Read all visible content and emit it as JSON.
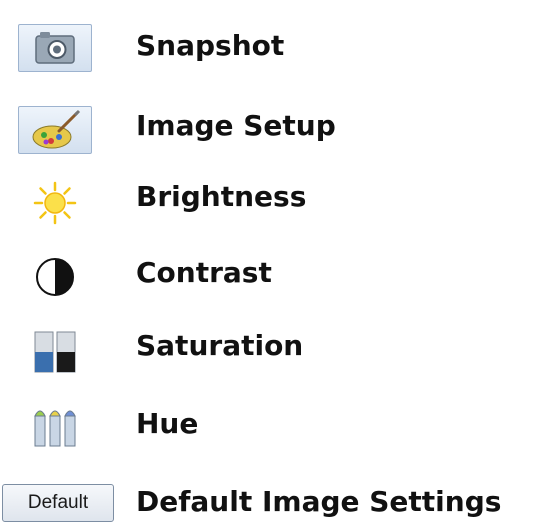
{
  "items": [
    {
      "label": "Snapshot",
      "icon": "camera-icon"
    },
    {
      "label": "Image Setup",
      "icon": "palette-icon"
    },
    {
      "label": "Brightness",
      "icon": "sun-icon"
    },
    {
      "label": "Contrast",
      "icon": "contrast-icon"
    },
    {
      "label": "Saturation",
      "icon": "saturation-icon"
    },
    {
      "label": "Hue",
      "icon": "hue-icon"
    },
    {
      "label": "Default Image Settings",
      "icon": "default-button"
    }
  ],
  "default_button_label": "Default"
}
